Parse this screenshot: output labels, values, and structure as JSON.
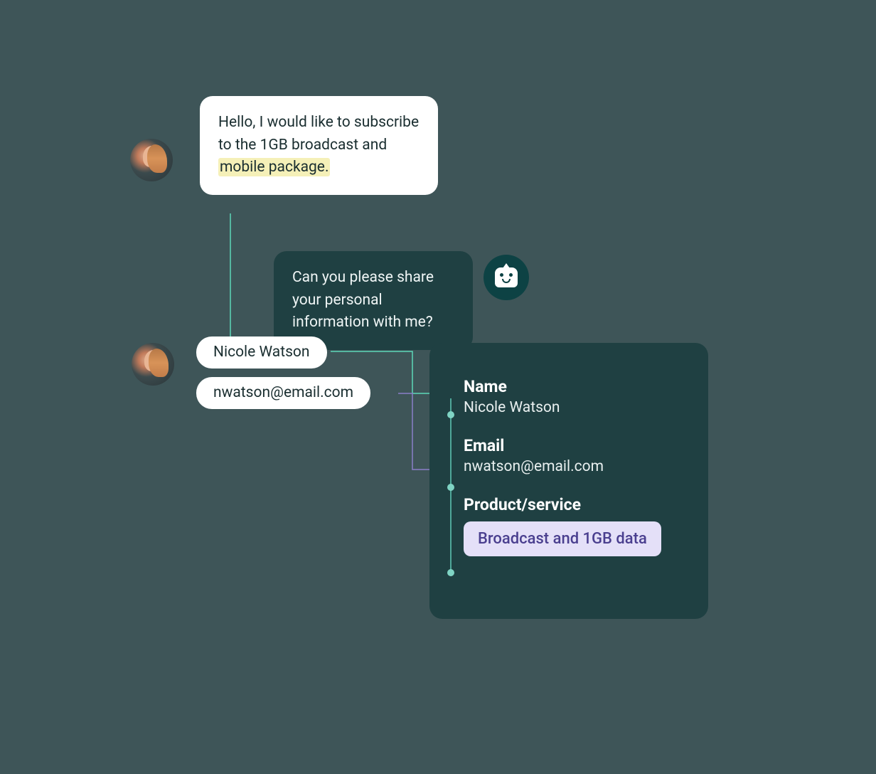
{
  "chat": {
    "user_message": {
      "text_before": "Hello, I would like to subscribe to the 1GB broadcast and ",
      "highlighted": "mobile package.",
      "text_after": ""
    },
    "bot_message": "Can you please share your personal information with me?",
    "response_name": "Nicole Watson",
    "response_email": "nwatson@email.com"
  },
  "panel": {
    "name_label": "Name",
    "name_value": "Nicole Watson",
    "email_label": "Email",
    "email_value": "nwatson@email.com",
    "product_label": "Product/service",
    "product_value": "Broadcast and 1GB data"
  }
}
